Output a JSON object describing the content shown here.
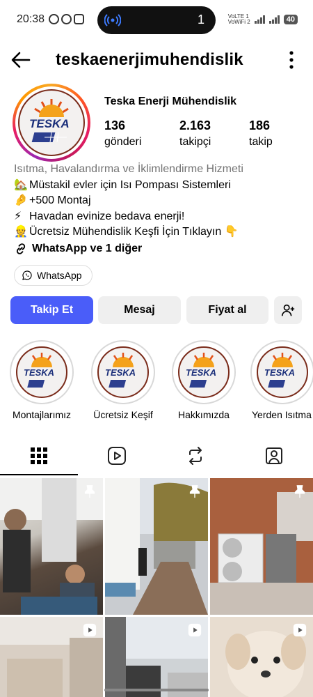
{
  "status_bar": {
    "time": "20:38",
    "notification_count": "1",
    "volte_line1": "VoLTE",
    "volte_line2": "VoWiFi",
    "sim1": "1",
    "sim2": "2",
    "battery": "40"
  },
  "header": {
    "username": "teskaenerjimuhendislik"
  },
  "profile": {
    "display_name": "Teska Enerji Mühendislik",
    "avatar_text": "TESKA",
    "stats": [
      {
        "value": "136",
        "label": "gönderi"
      },
      {
        "value": "2.163",
        "label": "takipçi"
      },
      {
        "value": "186",
        "label": "takip"
      }
    ],
    "category": "Isıtma, Havalandırma ve İklimlendirme Hizmeti",
    "bio_lines": [
      {
        "emoji": "🏡",
        "text": "Müstakil evler için Isı Pompası Sistemleri"
      },
      {
        "emoji": "🤌",
        "text": "+500 Montaj"
      },
      {
        "emoji": "⚡",
        "text": "Havadan evinize bedava enerji!"
      },
      {
        "emoji": "👷",
        "text": "Ücretsiz Mühendislik Keşfi İçin Tıklayın 👇"
      }
    ],
    "link_text": "WhatsApp ve 1 diğer",
    "whatsapp_chip": "WhatsApp"
  },
  "actions": {
    "follow": "Takip Et",
    "message": "Mesaj",
    "price": "Fiyat al"
  },
  "highlights": [
    {
      "label": "Montajlarımız",
      "logo": "TESKA"
    },
    {
      "label": "Ücretsiz Keşif",
      "logo": "TESKA"
    },
    {
      "label": "Hakkımızda",
      "logo": "TESKA"
    },
    {
      "label": "Yerden Isıtma",
      "logo": "TESKA"
    }
  ],
  "tabs": [
    {
      "icon": "grid-icon",
      "active": true
    },
    {
      "icon": "reels-icon",
      "active": false
    },
    {
      "icon": "repost-icon",
      "active": false
    },
    {
      "icon": "tagged-icon",
      "active": false
    }
  ],
  "grid_posts": [
    {
      "overlay": "pin-icon"
    },
    {
      "overlay": "pin-icon"
    },
    {
      "overlay": "pin-icon"
    },
    {
      "overlay": "reel-icon"
    },
    {
      "overlay": "reel-icon"
    },
    {
      "overlay": "reel-icon"
    }
  ],
  "colors": {
    "primary_button": "#4a5df9",
    "secondary_button": "#efefef",
    "category_text": "#737373",
    "logo_blue": "#1b2f7a"
  }
}
